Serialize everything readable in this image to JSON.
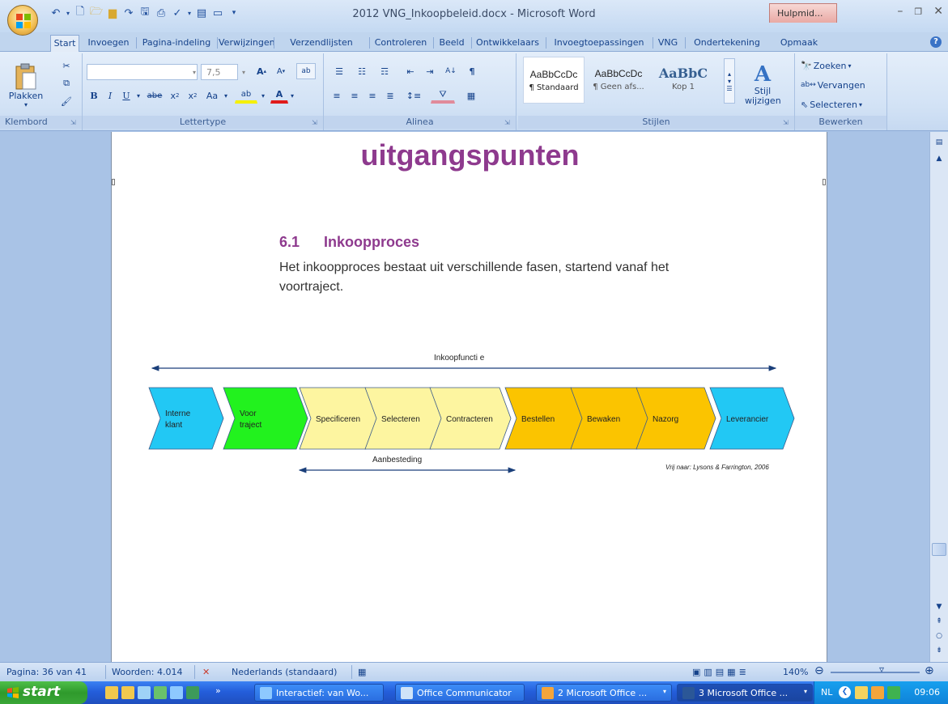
{
  "window": {
    "title": "2012 VNG_Inkoopbeleid.docx - Microsoft Word",
    "help_tab": "Hulpmid...",
    "controls": [
      "minimize",
      "restore",
      "close"
    ]
  },
  "ribbon_tabs": [
    "Start",
    "Invoegen",
    "Pagina-indeling",
    "Verwijzingen",
    "Verzendlijsten",
    "Controleren",
    "Beeld",
    "Ontwikkelaars",
    "Invoegtoepassingen",
    "VNG",
    "Ondertekening",
    "Opmaak"
  ],
  "ribbon": {
    "clipboard": {
      "paste_label": "Plakken",
      "group_label": "Klembord"
    },
    "font": {
      "font_name": "",
      "font_size": "7,5",
      "group_label": "Lettertype"
    },
    "paragraph": {
      "group_label": "Alinea"
    },
    "styles": {
      "group_label": "Stijlen",
      "items": [
        {
          "sample": "AaBbCcDc",
          "name": "¶ Standaard"
        },
        {
          "sample": "AaBbCcDc",
          "name": "¶ Geen afs..."
        },
        {
          "sample": "AaBbC",
          "name": "Kop 1"
        }
      ],
      "change_style_label": "Stijl wijzigen"
    },
    "editing": {
      "group_label": "Bewerken",
      "find": "Zoeken",
      "replace": "Vervangen",
      "select": "Selecteren"
    }
  },
  "document": {
    "heading_top": "uitgangspunten",
    "section_number": "6.1",
    "section_title": "Inkoopproces",
    "body": "Het inkoopproces bestaat uit verschillende fasen, startend vanaf het voortraject.",
    "diagram": {
      "top_label": "Inkoopfuncti e",
      "bottom_label": "Aanbesteding",
      "credit": "Vrij naar: Lysons & Farrington, 2006",
      "steps": [
        {
          "lines": [
            "Interne",
            "klant"
          ],
          "color": "#22c8f4"
        },
        {
          "lines": [
            "Voor",
            "traject"
          ],
          "color": "#22f21e"
        },
        {
          "lines": [
            "Specificeren"
          ],
          "color": "#fdf5a0"
        },
        {
          "lines": [
            "Selecteren"
          ],
          "color": "#fdf5a0"
        },
        {
          "lines": [
            "Contracteren"
          ],
          "color": "#fdf5a0"
        },
        {
          "lines": [
            "Bestellen"
          ],
          "color": "#fbc400"
        },
        {
          "lines": [
            "Bewaken"
          ],
          "color": "#fbc400"
        },
        {
          "lines": [
            "Nazorg"
          ],
          "color": "#fbc400"
        },
        {
          "lines": [
            "Leverancier"
          ],
          "color": "#22c8f4"
        }
      ]
    }
  },
  "statusbar": {
    "page": "Pagina: 36 van 41",
    "words": "Woorden: 4.014",
    "language": "Nederlands (standaard)",
    "zoom": "140%"
  },
  "taskbar": {
    "start_label": "start",
    "tasks": [
      {
        "label": "Interactief: van Wo...",
        "icon": "ie-icon"
      },
      {
        "label": "Office Communicator",
        "icon": "communicator-icon"
      },
      {
        "label": "2 Microsoft Office ...",
        "icon": "outlook-icon"
      },
      {
        "label": "3 Microsoft Office ...",
        "icon": "word-icon"
      }
    ],
    "language": "NL",
    "clock": "09:06"
  }
}
